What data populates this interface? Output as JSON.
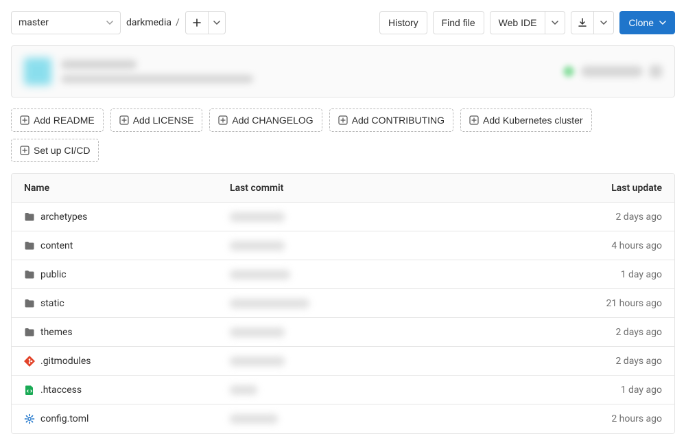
{
  "branch": {
    "selected": "master"
  },
  "breadcrumb": {
    "repo": "darkmedia"
  },
  "toolbar": {
    "history": "History",
    "find_file": "Find file",
    "web_ide": "Web IDE",
    "clone": "Clone"
  },
  "suggestions": [
    {
      "label": "Add README"
    },
    {
      "label": "Add LICENSE"
    },
    {
      "label": "Add CHANGELOG"
    },
    {
      "label": "Add CONTRIBUTING"
    },
    {
      "label": "Add Kubernetes cluster"
    },
    {
      "label": "Set up CI/CD"
    }
  ],
  "table": {
    "headers": {
      "name": "Name",
      "commit": "Last commit",
      "update": "Last update"
    },
    "rows": [
      {
        "icon": "folder",
        "name": "archetypes",
        "commit_blur_w": 80,
        "update": "2 days ago"
      },
      {
        "icon": "folder",
        "name": "content",
        "commit_blur_w": 80,
        "update": "4 hours ago"
      },
      {
        "icon": "folder",
        "name": "public",
        "commit_blur_w": 88,
        "update": "1 day ago"
      },
      {
        "icon": "folder",
        "name": "static",
        "commit_blur_w": 116,
        "update": "21 hours ago"
      },
      {
        "icon": "folder",
        "name": "themes",
        "commit_blur_w": 80,
        "update": "2 days ago"
      },
      {
        "icon": "git",
        "name": ".gitmodules",
        "commit_blur_w": 80,
        "update": "2 days ago"
      },
      {
        "icon": "code",
        "name": ".htaccess",
        "commit_blur_w": 40,
        "update": "1 day ago"
      },
      {
        "icon": "gear",
        "name": "config.toml",
        "commit_blur_w": 70,
        "update": "2 hours ago"
      }
    ]
  }
}
